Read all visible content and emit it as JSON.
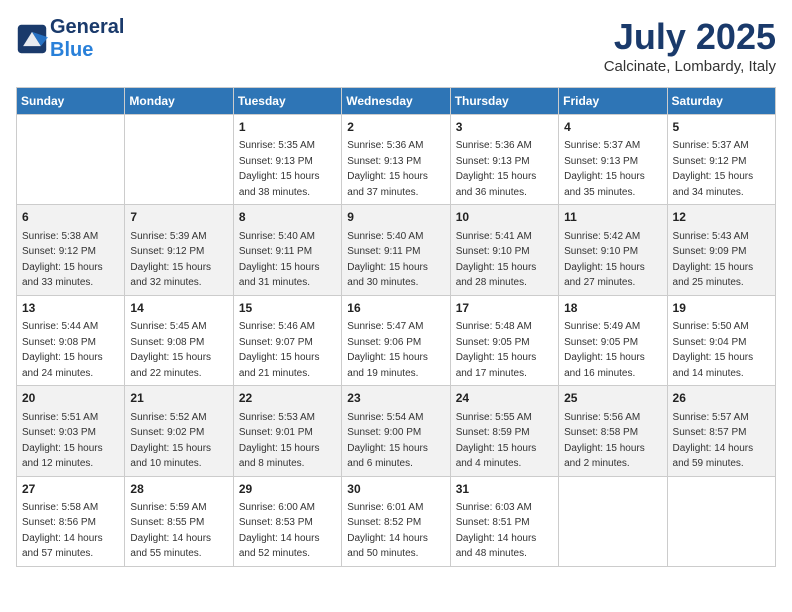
{
  "logo": {
    "line1": "General",
    "line2": "Blue"
  },
  "title": "July 2025",
  "location": "Calcinate, Lombardy, Italy",
  "days_of_week": [
    "Sunday",
    "Monday",
    "Tuesday",
    "Wednesday",
    "Thursday",
    "Friday",
    "Saturday"
  ],
  "weeks": [
    [
      {
        "day": "",
        "info": ""
      },
      {
        "day": "",
        "info": ""
      },
      {
        "day": "1",
        "info": "Sunrise: 5:35 AM\nSunset: 9:13 PM\nDaylight: 15 hours\nand 38 minutes."
      },
      {
        "day": "2",
        "info": "Sunrise: 5:36 AM\nSunset: 9:13 PM\nDaylight: 15 hours\nand 37 minutes."
      },
      {
        "day": "3",
        "info": "Sunrise: 5:36 AM\nSunset: 9:13 PM\nDaylight: 15 hours\nand 36 minutes."
      },
      {
        "day": "4",
        "info": "Sunrise: 5:37 AM\nSunset: 9:13 PM\nDaylight: 15 hours\nand 35 minutes."
      },
      {
        "day": "5",
        "info": "Sunrise: 5:37 AM\nSunset: 9:12 PM\nDaylight: 15 hours\nand 34 minutes."
      }
    ],
    [
      {
        "day": "6",
        "info": "Sunrise: 5:38 AM\nSunset: 9:12 PM\nDaylight: 15 hours\nand 33 minutes."
      },
      {
        "day": "7",
        "info": "Sunrise: 5:39 AM\nSunset: 9:12 PM\nDaylight: 15 hours\nand 32 minutes."
      },
      {
        "day": "8",
        "info": "Sunrise: 5:40 AM\nSunset: 9:11 PM\nDaylight: 15 hours\nand 31 minutes."
      },
      {
        "day": "9",
        "info": "Sunrise: 5:40 AM\nSunset: 9:11 PM\nDaylight: 15 hours\nand 30 minutes."
      },
      {
        "day": "10",
        "info": "Sunrise: 5:41 AM\nSunset: 9:10 PM\nDaylight: 15 hours\nand 28 minutes."
      },
      {
        "day": "11",
        "info": "Sunrise: 5:42 AM\nSunset: 9:10 PM\nDaylight: 15 hours\nand 27 minutes."
      },
      {
        "day": "12",
        "info": "Sunrise: 5:43 AM\nSunset: 9:09 PM\nDaylight: 15 hours\nand 25 minutes."
      }
    ],
    [
      {
        "day": "13",
        "info": "Sunrise: 5:44 AM\nSunset: 9:08 PM\nDaylight: 15 hours\nand 24 minutes."
      },
      {
        "day": "14",
        "info": "Sunrise: 5:45 AM\nSunset: 9:08 PM\nDaylight: 15 hours\nand 22 minutes."
      },
      {
        "day": "15",
        "info": "Sunrise: 5:46 AM\nSunset: 9:07 PM\nDaylight: 15 hours\nand 21 minutes."
      },
      {
        "day": "16",
        "info": "Sunrise: 5:47 AM\nSunset: 9:06 PM\nDaylight: 15 hours\nand 19 minutes."
      },
      {
        "day": "17",
        "info": "Sunrise: 5:48 AM\nSunset: 9:05 PM\nDaylight: 15 hours\nand 17 minutes."
      },
      {
        "day": "18",
        "info": "Sunrise: 5:49 AM\nSunset: 9:05 PM\nDaylight: 15 hours\nand 16 minutes."
      },
      {
        "day": "19",
        "info": "Sunrise: 5:50 AM\nSunset: 9:04 PM\nDaylight: 15 hours\nand 14 minutes."
      }
    ],
    [
      {
        "day": "20",
        "info": "Sunrise: 5:51 AM\nSunset: 9:03 PM\nDaylight: 15 hours\nand 12 minutes."
      },
      {
        "day": "21",
        "info": "Sunrise: 5:52 AM\nSunset: 9:02 PM\nDaylight: 15 hours\nand 10 minutes."
      },
      {
        "day": "22",
        "info": "Sunrise: 5:53 AM\nSunset: 9:01 PM\nDaylight: 15 hours\nand 8 minutes."
      },
      {
        "day": "23",
        "info": "Sunrise: 5:54 AM\nSunset: 9:00 PM\nDaylight: 15 hours\nand 6 minutes."
      },
      {
        "day": "24",
        "info": "Sunrise: 5:55 AM\nSunset: 8:59 PM\nDaylight: 15 hours\nand 4 minutes."
      },
      {
        "day": "25",
        "info": "Sunrise: 5:56 AM\nSunset: 8:58 PM\nDaylight: 15 hours\nand 2 minutes."
      },
      {
        "day": "26",
        "info": "Sunrise: 5:57 AM\nSunset: 8:57 PM\nDaylight: 14 hours\nand 59 minutes."
      }
    ],
    [
      {
        "day": "27",
        "info": "Sunrise: 5:58 AM\nSunset: 8:56 PM\nDaylight: 14 hours\nand 57 minutes."
      },
      {
        "day": "28",
        "info": "Sunrise: 5:59 AM\nSunset: 8:55 PM\nDaylight: 14 hours\nand 55 minutes."
      },
      {
        "day": "29",
        "info": "Sunrise: 6:00 AM\nSunset: 8:53 PM\nDaylight: 14 hours\nand 52 minutes."
      },
      {
        "day": "30",
        "info": "Sunrise: 6:01 AM\nSunset: 8:52 PM\nDaylight: 14 hours\nand 50 minutes."
      },
      {
        "day": "31",
        "info": "Sunrise: 6:03 AM\nSunset: 8:51 PM\nDaylight: 14 hours\nand 48 minutes."
      },
      {
        "day": "",
        "info": ""
      },
      {
        "day": "",
        "info": ""
      }
    ]
  ]
}
